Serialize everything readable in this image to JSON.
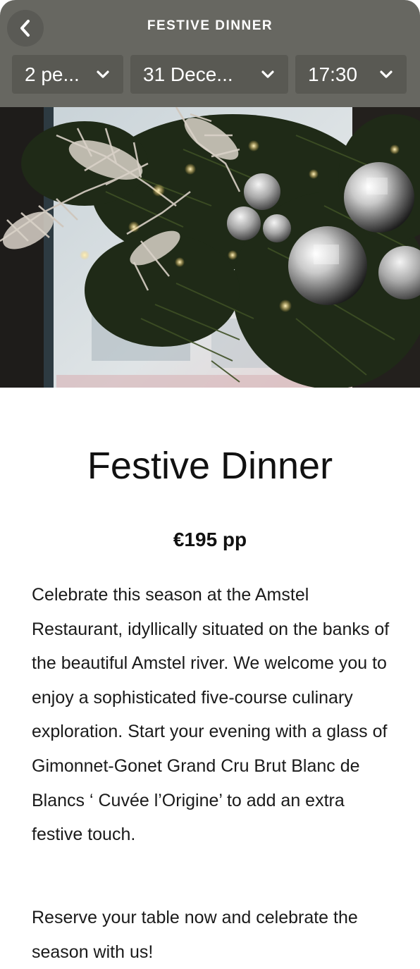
{
  "header": {
    "title": "FESTIVE DINNER",
    "background_color": "#676761",
    "back_icon": "chevron-left-icon"
  },
  "selectors": {
    "party_size": {
      "value": "2 pe...",
      "icon": "chevron-down-icon"
    },
    "date": {
      "value": "31 Dece...",
      "icon": "chevron-down-icon"
    },
    "time": {
      "value": "17:30",
      "icon": "chevron-down-icon"
    }
  },
  "hero": {
    "image_description": "Christmas garland with pine branches, silver baubles, silver glitter leaves and warm fairy lights by a window"
  },
  "main": {
    "heading": "Festive Dinner",
    "price": "€195 pp",
    "description": "Celebrate this season at the Amstel Restaurant, idyllically situated on the banks of the beautiful Amstel river. We welcome you to enjoy a sophisticated five-course culinary exploration. Start your evening with a glass of Gimonnet-Gonet Grand Cru Brut Blanc de Blancs ‘ Cuvée l’Origine’  to add an extra festive touch.",
    "cta_text": "Reserve your table now and celebrate the season with us!"
  }
}
